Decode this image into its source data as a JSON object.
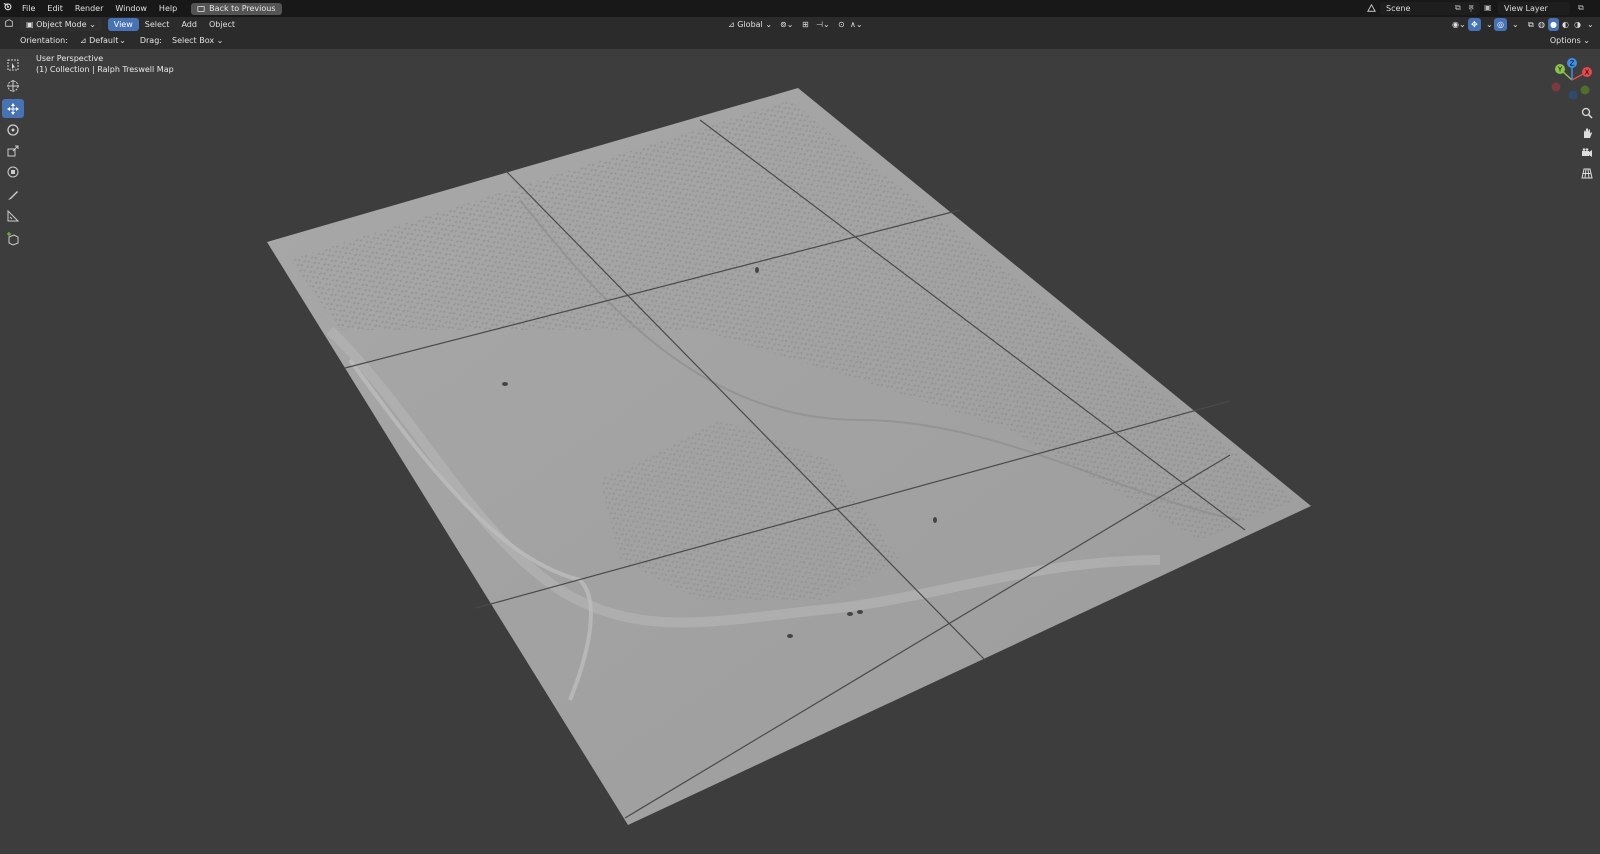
{
  "topbar": {
    "menus": [
      "File",
      "Edit",
      "Render",
      "Window",
      "Help"
    ],
    "back_button": "Back to Previous",
    "scene": "Scene",
    "view_layer": "View Layer"
  },
  "header": {
    "mode": "Object Mode",
    "menus": {
      "view": "View",
      "select": "Select",
      "add": "Add",
      "object": "Object"
    },
    "transform_space": "Global",
    "options": "Options"
  },
  "tool_settings": {
    "orientation_label": "Orientation:",
    "orientation_value": "Default",
    "drag_label": "Drag:",
    "drag_value": "Select Box"
  },
  "viewport": {
    "perspective": "User Perspective",
    "collection_info": "(1) Collection | Ralph Treswell Map"
  },
  "gizmo": {
    "x": "X",
    "y": "Y",
    "z": "Z",
    "colors": {
      "x": "#e8484e",
      "y": "#8bc34a",
      "z": "#3f8ee8"
    }
  },
  "colors": {
    "accent": "#4772b3",
    "viewport_bg": "#3d3d3d",
    "terrain": "#a4a4a4"
  },
  "tools": [
    "select-box",
    "cursor",
    "move",
    "rotate",
    "scale",
    "transform",
    "annotate",
    "measure",
    "add-cube"
  ],
  "nav_tools": [
    "zoom",
    "pan",
    "camera",
    "grid"
  ]
}
